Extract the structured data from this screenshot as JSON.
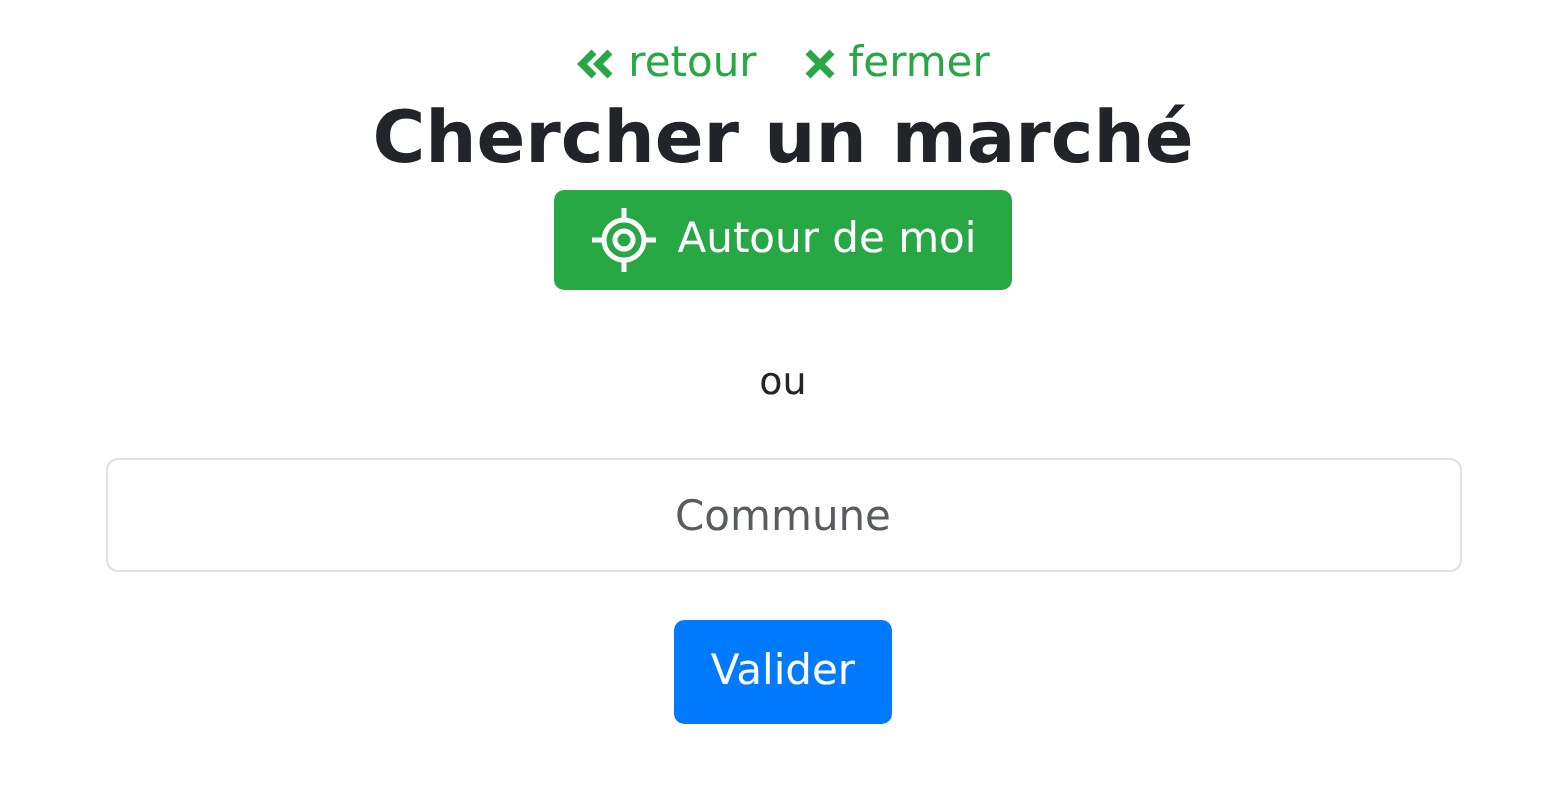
{
  "links": [
    {
      "kind": "back",
      "label": "retour"
    },
    {
      "kind": "close",
      "label": "fermer"
    }
  ],
  "title": "Chercher un marché",
  "locate_button": {
    "label": "Autour de moi"
  },
  "separator": "ou",
  "search": {
    "placeholder": "Commune"
  },
  "submit_button": {
    "label": "Valider"
  }
}
